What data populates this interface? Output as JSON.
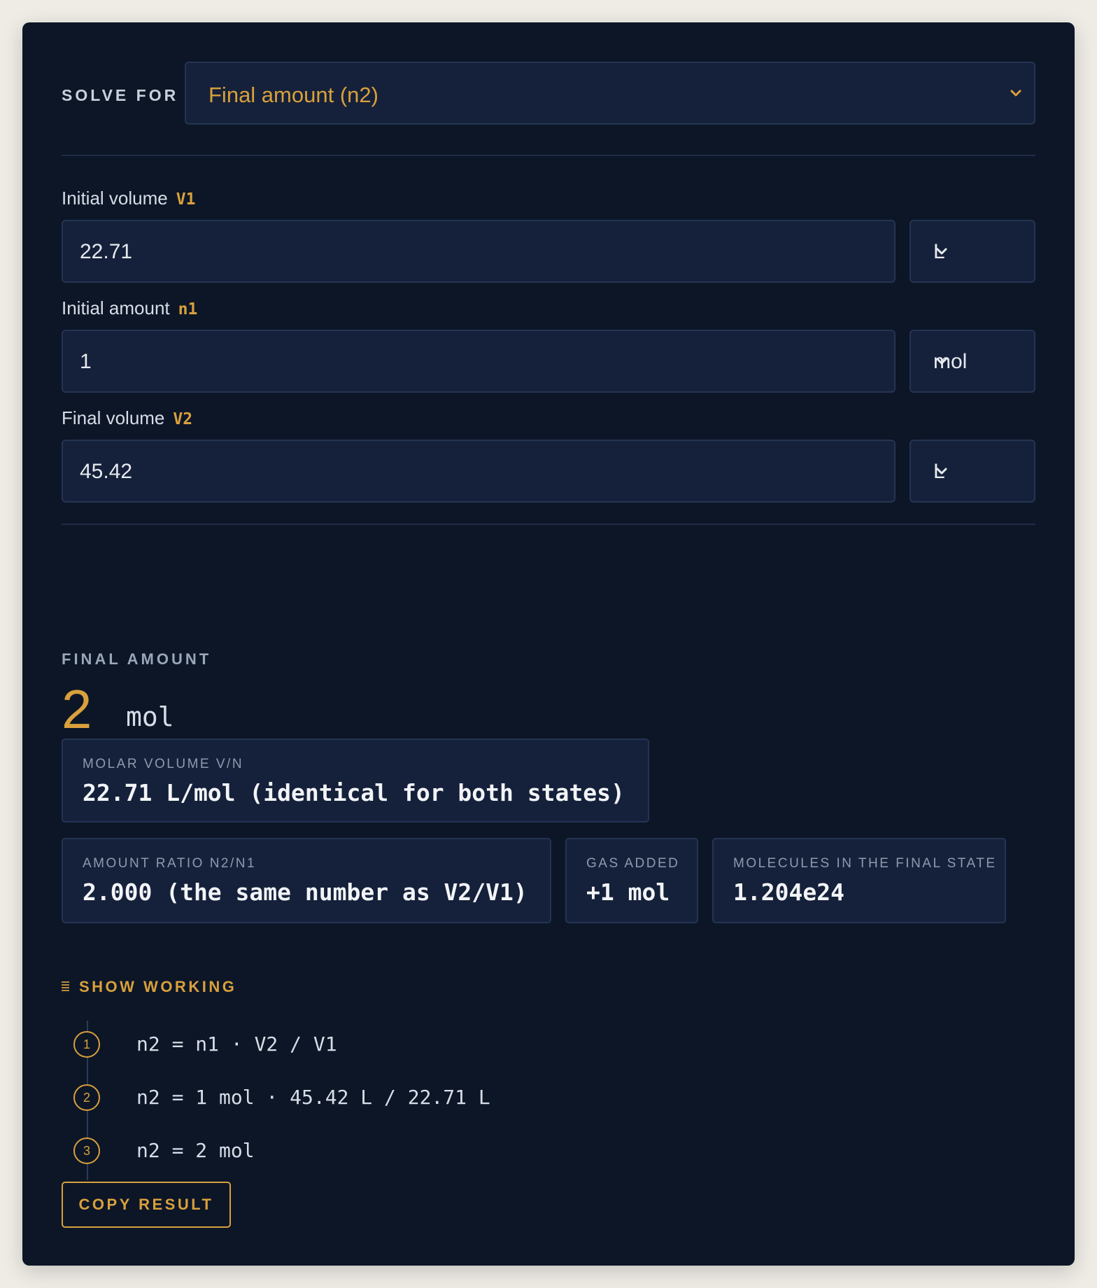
{
  "solve_for": {
    "label": "SOLVE FOR",
    "selected": "Final amount (n2)",
    "icon": "chevron-down-icon",
    "accent": "#d9a03c"
  },
  "fields": [
    {
      "label": "Initial volume",
      "symbol": "V1",
      "value": "22.71",
      "unit": "L"
    },
    {
      "label": "Initial amount",
      "symbol": "n1",
      "value": "1",
      "unit": "mol"
    },
    {
      "label": "Final volume",
      "symbol": "V2",
      "value": "45.42",
      "unit": "L"
    }
  ],
  "result": {
    "label": "FINAL AMOUNT",
    "value": "2",
    "unit": "mol"
  },
  "stats": [
    {
      "label": "MOLAR VOLUME V/N",
      "value": "22.71 L/mol (identical for both states)"
    },
    {
      "label": "AMOUNT RATIO N2/N1",
      "value": "2.000 (the same number as V2/V1)"
    },
    {
      "label": "GAS ADDED",
      "value": "+1 mol"
    },
    {
      "label": "MOLECULES IN THE FINAL STATE",
      "value": "1.204e24"
    }
  ],
  "working": {
    "toggle_label": "SHOW WORKING",
    "steps": [
      {
        "num": "1",
        "text": "n2 = n1 · V2 / V1"
      },
      {
        "num": "2",
        "text": "n2 = 1 mol · 45.42 L / 22.71 L"
      },
      {
        "num": "3",
        "text": "n2 = 2 mol"
      }
    ]
  },
  "copy_button": {
    "label": "COPY RESULT"
  },
  "colors": {
    "background": "#efece6",
    "card": "#0c1627",
    "panel": "#15213a",
    "accent": "#d9a03c"
  }
}
